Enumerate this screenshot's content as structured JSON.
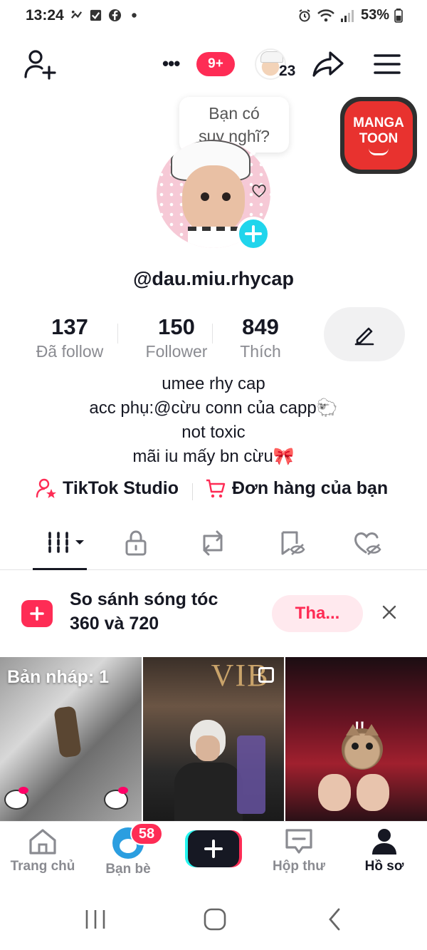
{
  "status_bar": {
    "time": "13:24",
    "battery": "53%",
    "icons_left": [
      "activity-icon",
      "checkbox-icon",
      "facebook-icon",
      "dot-icon"
    ],
    "icons_right": [
      "alarm-icon",
      "wifi-icon",
      "signal-icon",
      "battery-icon"
    ]
  },
  "top_nav": {
    "notification_badge": "9+",
    "viewer_count": "23",
    "icons": [
      "add-user-icon",
      "more-icon",
      "share-icon",
      "menu-icon"
    ]
  },
  "thought_bubble": {
    "line1": "Bạn có",
    "line2": "suy nghĩ?"
  },
  "mangatoon": {
    "line1": "MANGA",
    "line2": "TOON"
  },
  "profile": {
    "username": "@dau.miu.rhycap",
    "stats": [
      {
        "value": "137",
        "label": "Đã follow"
      },
      {
        "value": "150",
        "label": "Follower"
      },
      {
        "value": "849",
        "label": "Thích"
      }
    ],
    "bio": [
      "umee rhy cap",
      "acc phụ:@cừu conn của capp🐑",
      "not toxic",
      "mãi iu mấy bn cừu🎀"
    ]
  },
  "links": {
    "studio": "TikTok Studio",
    "orders": "Đơn hàng của bạn"
  },
  "tabs": [
    {
      "name": "videos",
      "icon": "grid-icon",
      "active": true
    },
    {
      "name": "private",
      "icon": "lock-icon"
    },
    {
      "name": "reposts",
      "icon": "repost-icon"
    },
    {
      "name": "favorites",
      "icon": "bookmark-hidden-icon"
    },
    {
      "name": "liked",
      "icon": "heart-hidden-icon"
    }
  ],
  "promo": {
    "line1": "So sánh sóng tóc",
    "line2": "360 và 720",
    "button": "Tha..."
  },
  "grid": {
    "draft_label": "Bản nháp: 1",
    "cell2_sign": "VIB"
  },
  "bottom_nav": {
    "items": [
      {
        "label": "Trang chủ",
        "icon": "home-icon"
      },
      {
        "label": "Bạn bè",
        "icon": "friends-avatar",
        "badge": "58"
      },
      {
        "label": "",
        "icon": "create-plus-icon"
      },
      {
        "label": "Hộp thư",
        "icon": "inbox-icon"
      },
      {
        "label": "Hồ sơ",
        "icon": "profile-icon",
        "active": true
      }
    ]
  },
  "colors": {
    "accent": "#fe2c55",
    "cyan": "#25f4ee",
    "text": "#161823",
    "muted": "#8a8b91"
  }
}
